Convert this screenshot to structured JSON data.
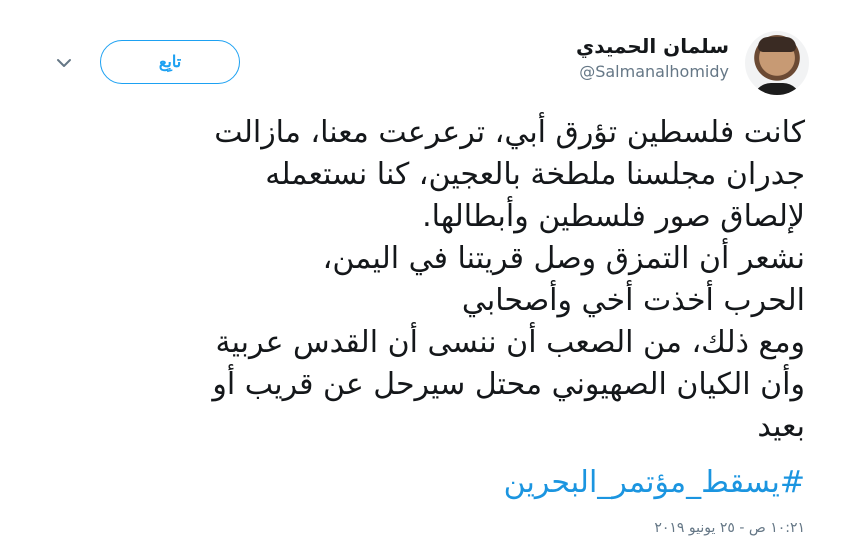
{
  "author": {
    "display_name": "سلمان الحميدي",
    "handle": "@Salmanalhomidy"
  },
  "follow_button": {
    "label": "تابِع"
  },
  "tweet": {
    "text": "كانت فلسطين تؤرق أبي، ترعرعت معنا، مازالت\nجدران مجلسنا ملطخة بالعجين، كنا نستعمله\nلإلصاق صور فلسطين وأبطالها.\nنشعر أن التمزق وصل قريتنا في اليمن،\nالحرب أخذت أخي وأصحابي\nومع ذلك، من الصعب أن ننسى أن القدس عربية\nوأن الكيان الصهيوني محتل سيرحل عن قريب أو\nبعيد",
    "hashtag": "#يسقط_مؤتمر_البحرين",
    "timestamp": "١٠:٢١ ص - ٢٥ يونيو ٢٠١٩"
  },
  "icons": {
    "avatar": "profile-photo",
    "chevron": "chevron-down-icon"
  }
}
